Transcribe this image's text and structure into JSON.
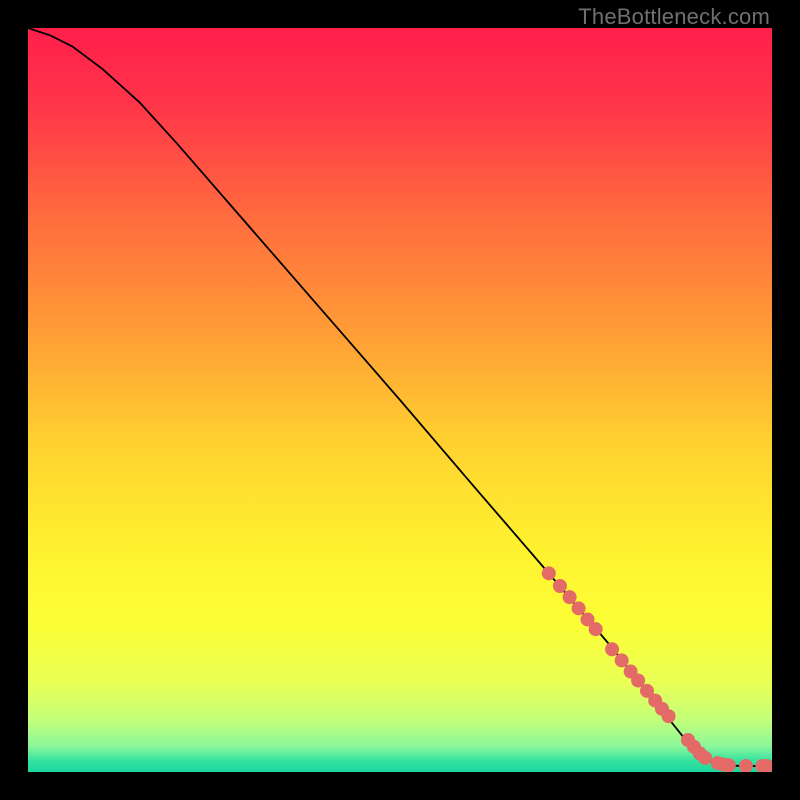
{
  "watermark": "TheBottleneck.com",
  "colors": {
    "bg": "#000000",
    "marker": "#e36a67",
    "line": "#000000",
    "gradient_stops": [
      {
        "offset": 0.0,
        "color": "#ff1f4b"
      },
      {
        "offset": 0.1,
        "color": "#ff3449"
      },
      {
        "offset": 0.25,
        "color": "#ff6a3e"
      },
      {
        "offset": 0.4,
        "color": "#ff9a36"
      },
      {
        "offset": 0.55,
        "color": "#ffcf30"
      },
      {
        "offset": 0.68,
        "color": "#ffee2f"
      },
      {
        "offset": 0.8,
        "color": "#fcff35"
      },
      {
        "offset": 0.88,
        "color": "#e9ff55"
      },
      {
        "offset": 0.93,
        "color": "#c4ff7a"
      },
      {
        "offset": 0.965,
        "color": "#8cf79a"
      },
      {
        "offset": 0.985,
        "color": "#35e3a0"
      },
      {
        "offset": 1.0,
        "color": "#19d8a0"
      }
    ]
  },
  "chart_data": {
    "type": "line",
    "title": "",
    "xlabel": "",
    "ylabel": "",
    "xlim": [
      0,
      100
    ],
    "ylim": [
      0,
      100
    ],
    "series": [
      {
        "name": "curve",
        "x": [
          0,
          3,
          6,
          10,
          15,
          20,
          30,
          40,
          50,
          60,
          70,
          78,
          80,
          82,
          84,
          86,
          88,
          90,
          92,
          94,
          96,
          98,
          100
        ],
        "y": [
          100,
          99,
          97.5,
          94.5,
          90,
          84.5,
          73,
          61.5,
          50,
          38.3,
          26.7,
          17.3,
          14.8,
          12.3,
          9.8,
          7.3,
          4.8,
          2.5,
          1.3,
          0.9,
          0.8,
          0.8,
          0.8
        ]
      }
    ],
    "markers": {
      "name": "highlighted-points",
      "x": [
        70,
        71.5,
        72.8,
        74,
        75.2,
        76.3,
        78.5,
        79.8,
        81,
        82,
        83.2,
        84.3,
        85.2,
        86.1,
        88.7,
        89.5,
        90.3,
        91,
        92.7,
        93.5,
        94.2,
        96.5,
        98.7,
        99.3
      ],
      "y": [
        26.7,
        25,
        23.5,
        22,
        20.5,
        19.2,
        16.5,
        15,
        13.5,
        12.3,
        10.9,
        9.6,
        8.5,
        7.5,
        4.3,
        3.4,
        2.5,
        1.9,
        1.2,
        1.0,
        0.9,
        0.8,
        0.8,
        0.8
      ]
    }
  }
}
